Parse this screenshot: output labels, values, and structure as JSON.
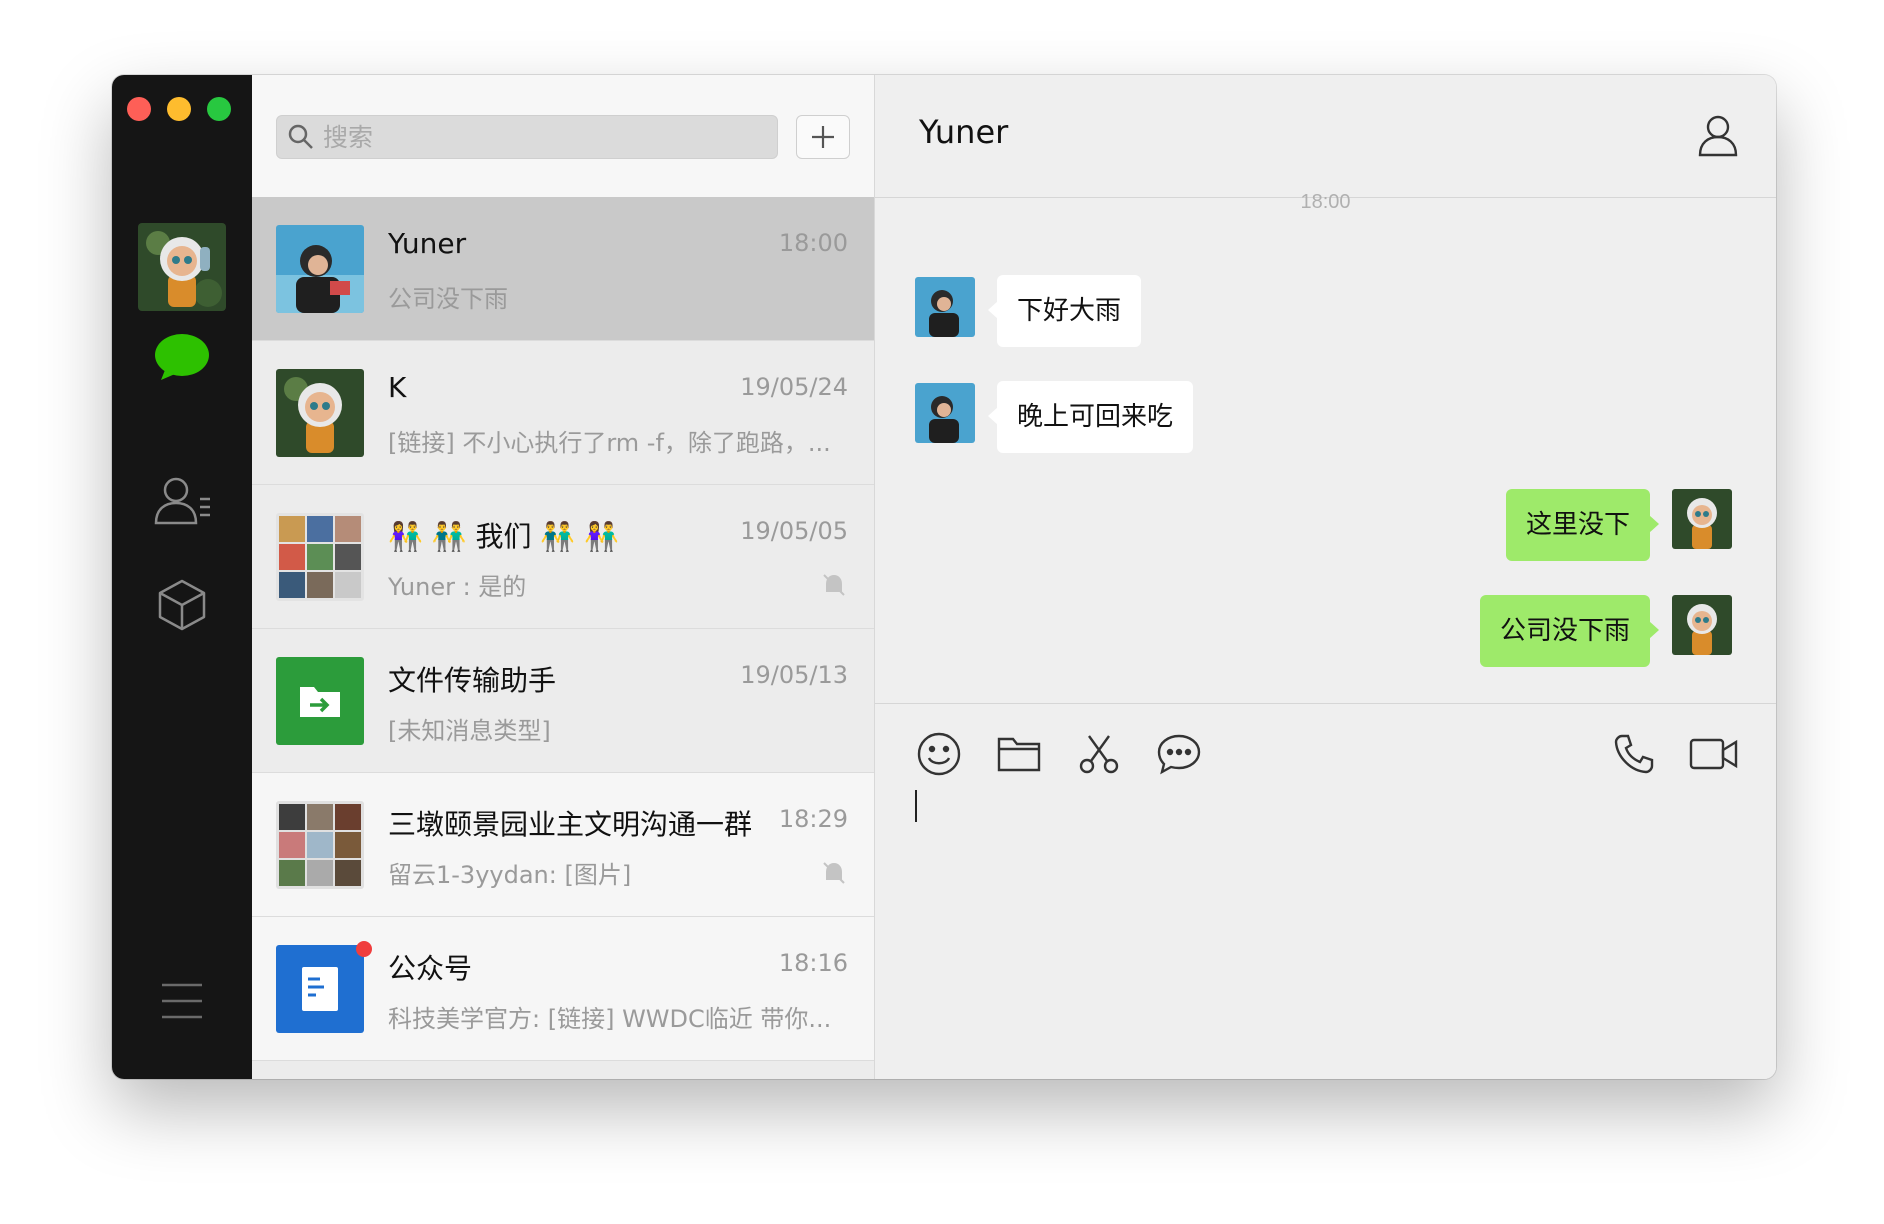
{
  "sidebar": {
    "icons": [
      "chat-icon",
      "contacts-icon",
      "favorites-icon",
      "menu-icon"
    ],
    "accent": "#2dc100"
  },
  "search": {
    "placeholder": "搜索"
  },
  "conversations": [
    {
      "name": "Yuner",
      "time": "18:00",
      "preview": "公司没下雨"
    },
    {
      "name": "K",
      "time": "19/05/24",
      "preview": "[链接] 不小心执行了rm -f，除了跑路，..."
    },
    {
      "name": "👫 👬 我们 👬 👫",
      "time": "19/05/05",
      "preview": "Yuner : 是的"
    },
    {
      "name": "文件传输助手",
      "time": "19/05/13",
      "preview": "[未知消息类型]"
    },
    {
      "name": "三墩颐景园业主文明沟通一群",
      "time": "18:29",
      "preview": "留云1-3yydan: [图片]"
    },
    {
      "name": "公众号",
      "time": "18:16",
      "preview": "科技美学官方: [链接] WWDC临近 带你..."
    }
  ],
  "chat": {
    "title": "Yuner",
    "timestamp": "18:00",
    "messages": [
      {
        "direction": "in",
        "text": "下好大雨"
      },
      {
        "direction": "in",
        "text": "晚上可回来吃"
      },
      {
        "direction": "out",
        "text": "这里没下"
      },
      {
        "direction": "out",
        "text": "公司没下雨"
      }
    ],
    "bubble_out_color": "#9eea6a"
  }
}
